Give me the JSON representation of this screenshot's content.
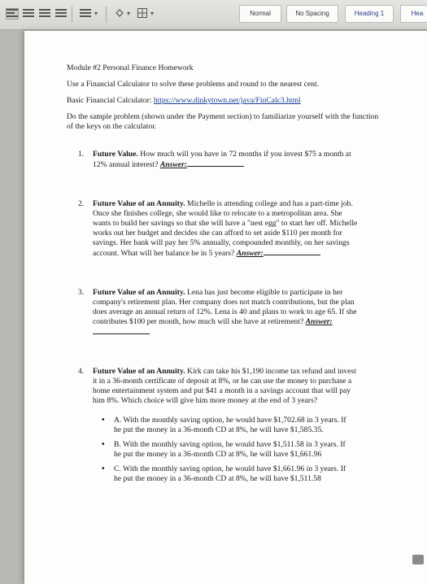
{
  "toolbar": {
    "styles": [
      "Normal",
      "No Spacing",
      "Heading 1",
      "Hea"
    ],
    "chevron": "▾"
  },
  "document": {
    "title": "Module #2 Personal Finance Homework",
    "instructions": "Use a Financial Calculator to solve these problems and round to the nearest cent.",
    "calc_label": "Basic Financial Calculator: ",
    "calc_link": "https://www.dinkytown.net/java/FinCalc3.html",
    "sample_note": "Do the sample problem (shown under the Payment section) to familiarize yourself with the function of the keys on the calculator.",
    "answer_label": "Answer:",
    "questions": [
      {
        "num": "1.",
        "heading": "Future Value.",
        "text": " How much will you have in 72 months if you invest $75 a month at 12% annual interest? "
      },
      {
        "num": "2.",
        "heading": "Future Value of an Annuity.",
        "text": " Michelle is attending college and has a part-time job. Once she finishes college, she would like to relocate to a metropolitan area. She wants to build her savings so that she will have a \"nest egg\" to start her off. Michelle works out her budget and decides she can afford to set aside $110 per month for savings. Her bank will pay her 5% annually, compounded monthly, on her savings account. What will her balance be in 5 years? "
      },
      {
        "num": "3.",
        "heading": "Future Value of an Annuity.",
        "text": " Lena has just become eligible to participate in her company's retirement plan. Her company does not match contributions, but the plan does average an annual return of 12%. Lena is 40 and plans to work to age 65. If she contributes $100 per month, how much will she have at retirement? "
      },
      {
        "num": "4.",
        "heading": "Future Value of an Annuity.",
        "text": " Kirk can take his $1,190 income tax refund and invest it in a 36-month certificate of deposit at 8%, or he can use the money to purchase a home entertainment system and put $41 a month in a savings account that will pay him 8%. Which choice will give him more money at the end of 3 years?"
      }
    ],
    "options": [
      "A. With the monthly saving option, he would have $1,702.68 in 3 years. If he put the money in a 36-month CD at 8%, he will have $1,585.35.",
      "B. With the monthly saving option, he would have $1,511.58 in 3 years. If he put the money in a 36-month CD at 8%, he will have $1,661.96",
      "C. With the monthly saving option, he would have $1,661.96 in 3 years. If he put the money in a 36-month CD at 8%, he will have $1,511.58"
    ],
    "bullet": "•"
  }
}
